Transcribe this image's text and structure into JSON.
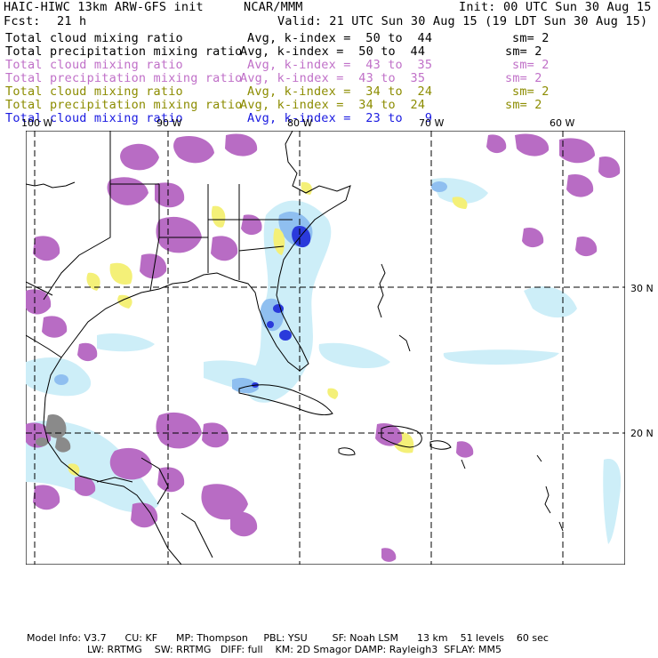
{
  "header": {
    "title": "HAIC-HIWC 13km ARW-GFS init",
    "org": "NCAR/MMM",
    "init": "Init: 00 UTC Sun 30 Aug 15",
    "fcst_label": "Fcst:",
    "fcst_value": "21 h",
    "valid": "Valid: 21 UTC Sun 30 Aug 15 (19 LDT Sun 30 Aug 15)"
  },
  "fields": [
    {
      "name": "Total cloud mixing ratio",
      "avg": "Avg, k-index =  50 to  44",
      "sm": "sm= 2",
      "color": "#000000"
    },
    {
      "name": "Total precipitation mixing ratio",
      "avg": "Avg, k-index =  50 to  44",
      "sm": "sm= 2",
      "color": "#000000"
    },
    {
      "name": "Total cloud mixing ratio",
      "avg": "Avg, k-index =  43 to  35",
      "sm": "sm= 2",
      "color": "#c070c8"
    },
    {
      "name": "Total precipitation mixing ratio",
      "avg": "Avg, k-index =  43 to  35",
      "sm": "sm= 2",
      "color": "#c070c8"
    },
    {
      "name": "Total cloud mixing ratio",
      "avg": "Avg, k-index =  34 to  24",
      "sm": "sm= 2",
      "color": "#8c8c00"
    },
    {
      "name": "Total precipitation mixing ratio",
      "avg": "Avg, k-index =  34 to  24",
      "sm": "sm= 2",
      "color": "#8c8c00"
    },
    {
      "name": "Total cloud mixing ratio",
      "avg": "Avg, k-index =  23 to   9",
      "sm": "",
      "color": "#1a1ae0"
    }
  ],
  "map": {
    "lon_labels": [
      "100 W",
      "90 W",
      "80 W",
      "70 W",
      "60 W"
    ],
    "lat_labels": [
      "30 N",
      "20 N"
    ],
    "colors": {
      "light_blue": "#cdeef8",
      "mid_blue": "#8fbff0",
      "dark_blue": "#2a3adb",
      "purple": "#b86cc4",
      "yellow": "#f4f078",
      "gray": "#8a8a8a"
    }
  },
  "footer": {
    "line1": "Model Info: V3.7      CU: KF      MP: Thompson     PBL: YSU        SF: Noah LSM      13 km    51 levels    60 sec",
    "line2": "LW: RRTMG    SW: RRTMG   DIFF: full    KM: 2D Smagor DAMP: Rayleigh3  SFLAY: MM5"
  }
}
